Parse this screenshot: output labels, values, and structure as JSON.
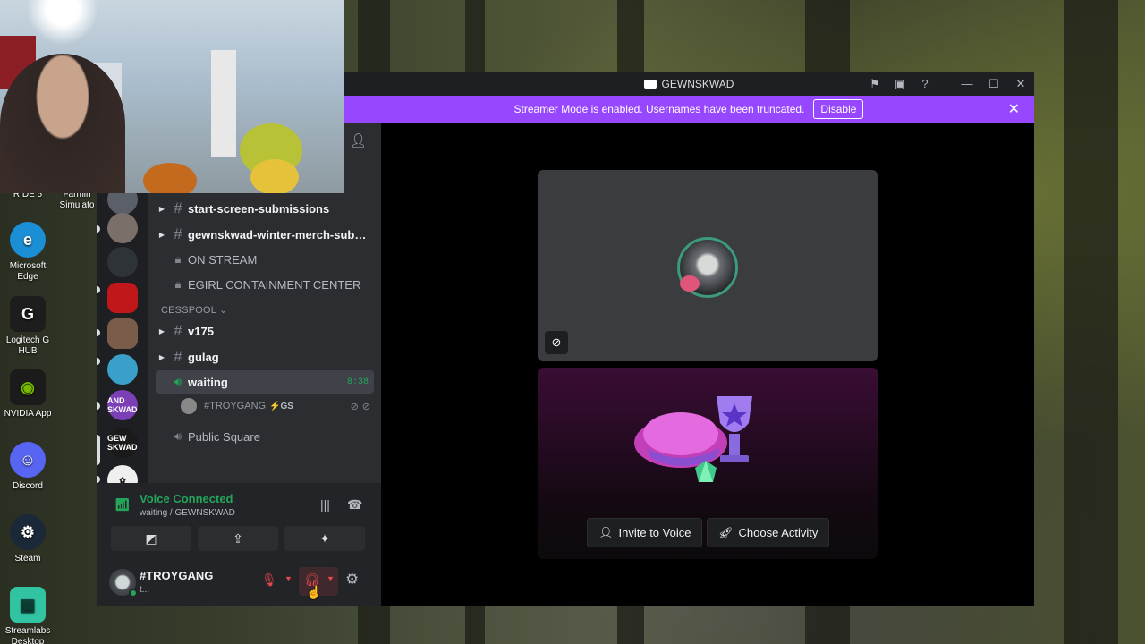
{
  "desktop": {
    "icons": [
      {
        "label_line1": "RIDE 5",
        "label_line2": "",
        "icon": "game-icon",
        "color": "#444444"
      },
      {
        "label_line1": "Farmin",
        "label_line2": "Simulato",
        "icon": "game-icon",
        "color": "#555555"
      },
      {
        "label_line1": "Microsoft",
        "label_line2": "Edge",
        "icon": "edge-icon",
        "color": "#1b8fd6"
      },
      {
        "label_line1": "Logitech G",
        "label_line2": "HUB",
        "icon": "logitech-icon",
        "color": "#1d1d1d"
      },
      {
        "label_line1": "NVIDIA App",
        "label_line2": "",
        "icon": "nvidia-icon",
        "color": "#76b900"
      },
      {
        "label_line1": "Discord",
        "label_line2": "",
        "icon": "discord-icon",
        "color": "#5865f2"
      },
      {
        "label_line1": "Steam",
        "label_line2": "",
        "icon": "steam-icon",
        "color": "#1b2838"
      },
      {
        "label_line1": "Streamlabs",
        "label_line2": "Desktop",
        "icon": "streamlabs-icon",
        "color": "#31c3a2"
      }
    ]
  },
  "window": {
    "title": "GEWNSKWAD",
    "toolbar_icons": [
      "flag-icon",
      "screen-icon",
      "help-icon"
    ],
    "controls": [
      "minimize-icon",
      "maximize-icon",
      "close-icon"
    ]
  },
  "streamer_banner": {
    "text": "Streamer Mode is enabled. Usernames have been truncated.",
    "button": "Disable",
    "bg": "#9747ff"
  },
  "servers": [
    {
      "initials": "",
      "color": "#5a5f68"
    },
    {
      "initials": "",
      "color": "#7b6f6a"
    },
    {
      "initials": "",
      "color": "#2e3338"
    },
    {
      "initials": "",
      "color": "#c0171b"
    },
    {
      "initials": "",
      "color": "#7a5c4a"
    },
    {
      "initials": "",
      "color": "#3aa0c9"
    },
    {
      "initials": "AND SKWAD",
      "color": "#7b3fb6"
    },
    {
      "initials": "GEW SKWAD",
      "color": "#1a1a1a"
    },
    {
      "initials": "",
      "color": "#efefef"
    }
  ],
  "channels": {
    "text_top": [
      {
        "name": "start-screen-submissions"
      },
      {
        "name": "gewnskwad-winter-merch-submi..."
      }
    ],
    "locked": [
      {
        "name": "ON STREAM"
      },
      {
        "name": "EGIRL CONTAINMENT CENTER"
      }
    ],
    "category": "CESSPOOL",
    "category_text": [
      {
        "name": "v175"
      },
      {
        "name": "gulag"
      }
    ],
    "active_voice": {
      "name": "waiting",
      "timer": "8:38"
    },
    "voice_user": {
      "name": "#TROYGANG",
      "tag": "GS"
    },
    "other_voice": {
      "name": "Public Square"
    }
  },
  "voice_panel": {
    "status": "Voice Connected",
    "location": "waiting / GEWNSKWAD",
    "status_color": "#23a55a"
  },
  "user": {
    "name": "#TROYGANG",
    "status": "t..."
  },
  "stage": {
    "buttons": {
      "invite": "Invite to Voice",
      "activity": "Choose Activity"
    }
  }
}
